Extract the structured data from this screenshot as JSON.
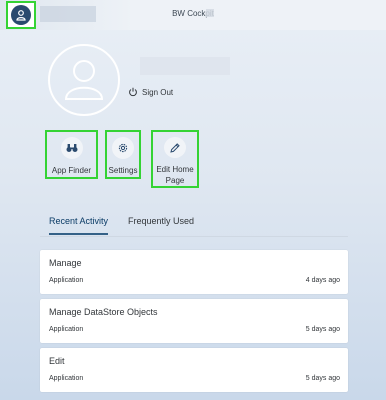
{
  "shell": {
    "title": "BW Cockpit"
  },
  "profile": {
    "sign_out_label": "Sign Out"
  },
  "actions": [
    {
      "label": "App Finder",
      "icon": "binoculars-icon"
    },
    {
      "label": "Settings",
      "icon": "gear-icon"
    },
    {
      "label": "Edit Home Page",
      "icon": "pencil-icon"
    }
  ],
  "tabs": [
    {
      "label": "Recent Activity",
      "selected": true
    },
    {
      "label": "Frequently Used",
      "selected": false
    }
  ],
  "activity": [
    {
      "title": "Manage",
      "type": "Application",
      "time": "4 days ago"
    },
    {
      "title": "Manage DataStore Objects",
      "type": "Application",
      "time": "5 days ago"
    },
    {
      "title": "Edit",
      "type": "Application",
      "time": "5 days ago"
    }
  ],
  "colors": {
    "accent": "#346187",
    "highlight": "#34d334",
    "avatar": "#2a4a6e"
  }
}
